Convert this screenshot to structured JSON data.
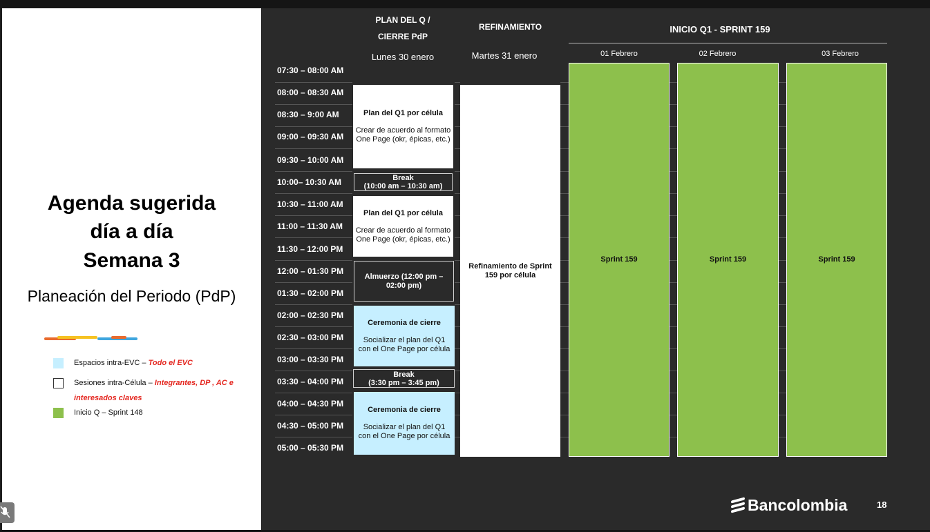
{
  "slide": {
    "title_lines": [
      "Agenda sugerida",
      "día a día",
      "Semana 3"
    ],
    "subtitle": "Planeación del Periodo (PdP)",
    "page_number": "18",
    "logo_text": "Bancolombia",
    "accent_colors": [
      "#e96b2d",
      "#f6c221",
      "#3fa6de"
    ]
  },
  "legend": [
    {
      "swatch_color": "#c6efff",
      "label": "Espacios intra-EVC – ",
      "emphasis": "Todo el EVC"
    },
    {
      "swatch_color": "#ffffff",
      "label": "Sesiones intra-Célula – ",
      "emphasis": "Integrantes, DP , AC e",
      "emphasis2": "interesados claves"
    },
    {
      "swatch_color": "#8dc04c",
      "label": "Inicio Q – Sprint 148"
    }
  ],
  "headers": {
    "col1_line1": "PLAN DEL Q /",
    "col1_line2": "CIERRE PdP",
    "col1_day": "Lunes 30 enero",
    "col2": "REFINAMIENTO",
    "col2_day": "Martes 31 enero",
    "col3": "INICIO Q1 - SPRINT 159",
    "dates": [
      "01 Febrero",
      "02 Febrero",
      "03 Febrero"
    ]
  },
  "time_slots": [
    "07:30 – 08:00 AM",
    "08:00 – 08:30 AM",
    "08:30 – 9:00 AM",
    "09:00 – 09:30 AM",
    "09:30 – 10:00 AM",
    "10:00– 10:30 AM",
    "10:30 – 11:00 AM",
    "11:00 – 11:30 AM",
    "11:30 – 12:00 PM",
    "12:00 – 01:30 PM",
    "01:30 – 02:00 PM",
    "02:00 – 02:30 PM",
    "02:30 – 03:00 PM",
    "03:00 – 03:30 PM",
    "03:30 – 04:00 PM",
    "04:00 – 04:30 PM",
    "04:30 – 05:00 PM",
    "05:00 – 05:30 PM"
  ],
  "blocks": {
    "plan1": {
      "title": "Plan del Q1 por célula",
      "desc": "Crear de acuerdo al formato One Page (okr, épicas, etc.)"
    },
    "break1": {
      "title": "Break",
      "desc": "(10:00 am – 10:30 am)"
    },
    "plan2": {
      "title": "Plan del Q1 por célula",
      "desc": "Crear de acuerdo al formato One Page (okr, épicas, etc.)"
    },
    "lunch": {
      "title": "Almuerzo (12:00 pm – 02:00 pm)"
    },
    "cer1": {
      "title": "Ceremonia de cierre",
      "desc": "Socializar el plan del Q1 con el One Page por célula"
    },
    "break2": {
      "title": "Break",
      "desc": "(3:30 pm – 3:45 pm)"
    },
    "cer2": {
      "title": "Ceremonia de cierre",
      "desc": "Socializar el plan del Q1 con el One Page por célula"
    },
    "refine": {
      "title": "Refinamiento de Sprint 159 por célula"
    },
    "sprint": [
      "Sprint 159",
      "Sprint 159",
      "Sprint 159"
    ]
  }
}
